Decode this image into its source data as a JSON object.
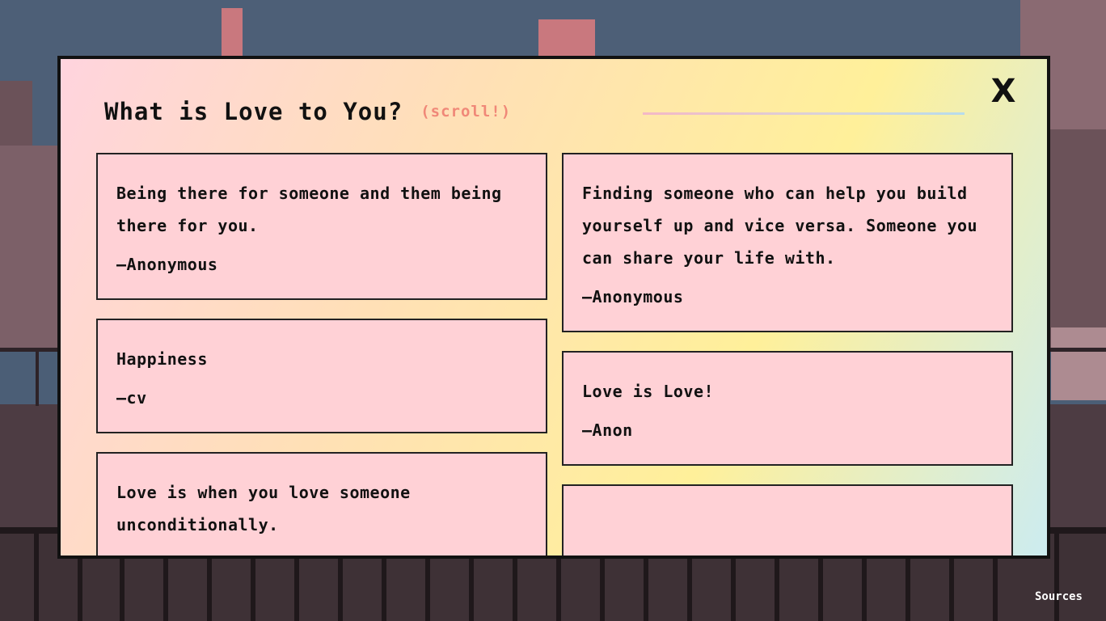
{
  "modal": {
    "title": "What is Love to You?",
    "scroll_hint": "(scroll!)",
    "close_label": "X"
  },
  "cards_left": [
    {
      "message": "Being there for someone and them being there for you.",
      "author": "—Anonymous"
    },
    {
      "message": "Happiness",
      "author": "—cv"
    },
    {
      "message": "Love is when you love someone unconditionally.",
      "author": ""
    }
  ],
  "cards_right": [
    {
      "message": "Finding someone who can help you build yourself up and vice versa. Someone you can share your life with.",
      "author": "—Anonymous"
    },
    {
      "message": "Love is Love!",
      "author": "—Anon"
    },
    {
      "message": "",
      "author": ""
    }
  ],
  "footer": {
    "sources_label": "Sources"
  },
  "colors": {
    "card_bg": "#ffd1d6",
    "scroll_hint": "#f08878",
    "border": "#111111"
  }
}
